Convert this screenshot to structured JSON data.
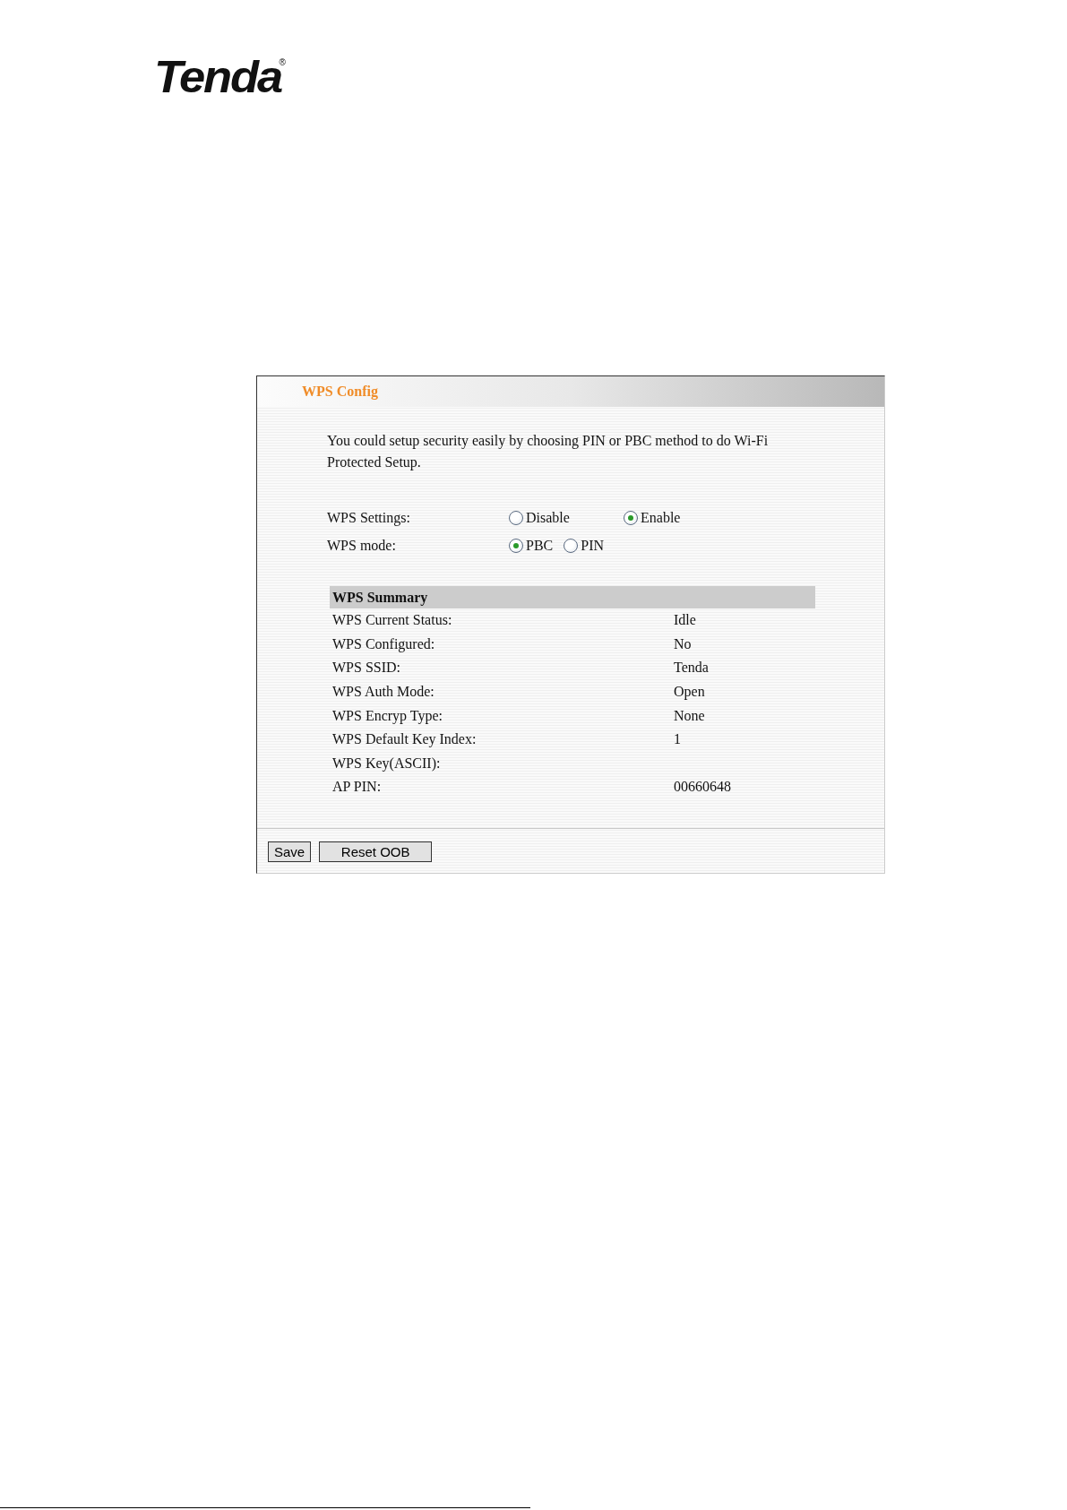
{
  "logo": {
    "text": "Tenda",
    "mark": "®"
  },
  "panel": {
    "title": "WPS Config",
    "intro": "You could setup security easily by choosing PIN or PBC method to do Wi-Fi Protected Setup.",
    "settings": [
      {
        "label": "WPS Settings:",
        "options": [
          {
            "label": "Disable",
            "selected": false
          },
          {
            "label": "Enable",
            "selected": true
          }
        ]
      },
      {
        "label": "WPS mode:",
        "options": [
          {
            "label": "PBC",
            "selected": true
          },
          {
            "label": "PIN",
            "selected": false
          }
        ]
      }
    ],
    "summary": {
      "title": "WPS Summary",
      "rows": [
        {
          "label": "WPS Current Status:",
          "value": "Idle"
        },
        {
          "label": "WPS Configured:",
          "value": "No"
        },
        {
          "label": "WPS SSID:",
          "value": "Tenda"
        },
        {
          "label": "WPS Auth Mode:",
          "value": "Open"
        },
        {
          "label": "WPS Encryp Type:",
          "value": "None"
        },
        {
          "label": "WPS Default Key Index:",
          "value": "1"
        },
        {
          "label": "WPS Key(ASCII):"
        },
        {
          "label": "AP PIN:",
          "value": "00660648"
        }
      ]
    },
    "buttons": [
      "Save",
      "Reset OOB"
    ]
  }
}
